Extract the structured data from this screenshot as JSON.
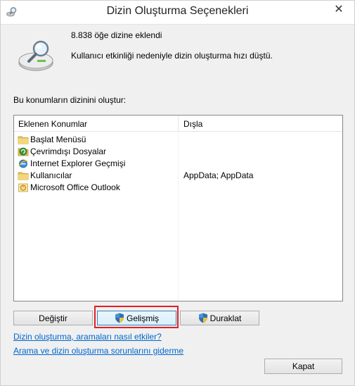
{
  "window": {
    "title": "Dizin Oluşturma Seçenekleri",
    "close_glyph": "✕"
  },
  "status": {
    "items_indexed": "8.838 öğe dizine eklendi",
    "speed_message": "Kullanıcı etkinliği nedeniyle dizin oluşturma hızı düştü."
  },
  "section_label": "Bu konumların dizinini oluştur:",
  "locations": {
    "columns": [
      "Eklenen Konumlar",
      "Dışla"
    ],
    "rows": [
      {
        "name": "Başlat Menüsü",
        "exclude": "",
        "icon": "folder-icon"
      },
      {
        "name": "Çevrimdışı Dosyalar",
        "exclude": "",
        "icon": "offline-files-icon"
      },
      {
        "name": "Internet Explorer Geçmişi",
        "exclude": "",
        "icon": "internet-explorer-icon"
      },
      {
        "name": "Kullanıcılar",
        "exclude": "AppData; AppData",
        "icon": "folder-icon"
      },
      {
        "name": "Microsoft Office Outlook",
        "exclude": "",
        "icon": "outlook-icon"
      }
    ]
  },
  "buttons": {
    "modify": "Değiştir",
    "advanced": "Gelişmiş",
    "pause": "Duraklat",
    "close": "Kapat"
  },
  "links": {
    "how_affects": "Dizin oluşturma, aramaları nasıl etkiler?",
    "troubleshoot": "Arama ve dizin oluşturma sorunlarını giderme"
  },
  "colors": {
    "link": "#0066cc",
    "highlight_border": "#e0202a",
    "folder": "#e8c458"
  }
}
